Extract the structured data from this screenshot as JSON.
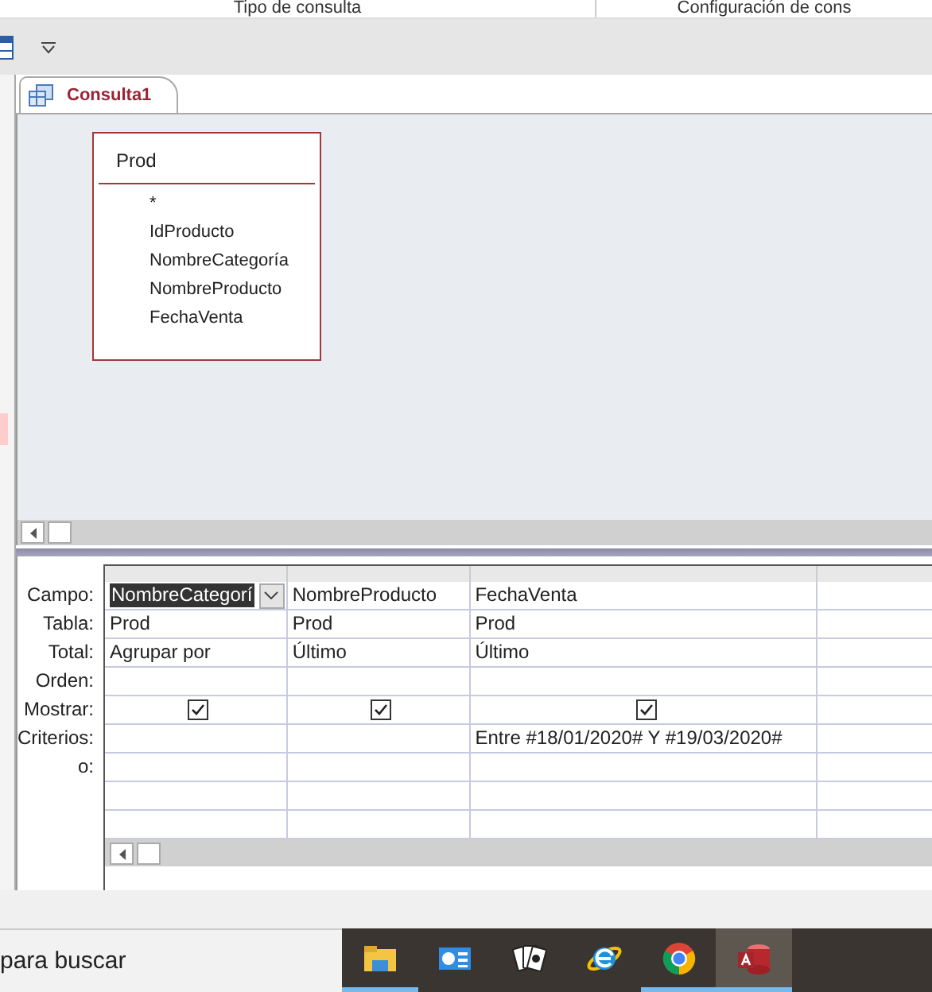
{
  "ribbon_groups": [
    "Tipo de consulta",
    "Configuración de cons"
  ],
  "document_tab": {
    "label": "Consulta1",
    "selected": true
  },
  "table_box": {
    "title": "Prod",
    "fields": [
      "*",
      "IdProducto",
      "NombreCategoría",
      "NombreProducto",
      "FechaVenta"
    ]
  },
  "grid": {
    "rows": [
      {
        "label": "Campo:",
        "kind": "campo"
      },
      {
        "label": "Tabla:",
        "kind": "tabla"
      },
      {
        "label": "Total:",
        "kind": "total"
      },
      {
        "label": "Orden:",
        "kind": "orden"
      },
      {
        "label": "Mostrar:",
        "kind": "mostrar"
      },
      {
        "label": "Criterios:",
        "kind": "criterios"
      },
      {
        "label": "o:",
        "kind": "o"
      }
    ],
    "columns": [
      {
        "campo": "NombreCategorí",
        "selected": true,
        "tabla": "Prod",
        "total": "Agrupar por",
        "mostrar": true
      },
      {
        "campo": "NombreProducto",
        "selected": false,
        "tabla": "Prod",
        "total": "Último",
        "mostrar": true
      },
      {
        "campo": "FechaVenta",
        "selected": false,
        "tabla": "Prod",
        "total": "Último",
        "mostrar": true,
        "criterios": "Entre #18/01/2020# Y #19/03/2020#"
      }
    ]
  },
  "taskbar": {
    "search_placeholder": "para buscar",
    "apps": [
      {
        "kind": "folder",
        "running": true,
        "active": false
      },
      {
        "kind": "panel",
        "running": false,
        "active": false
      },
      {
        "kind": "cards",
        "running": false,
        "active": false
      },
      {
        "kind": "ie",
        "running": false,
        "active": false
      },
      {
        "kind": "chrome",
        "running": true,
        "active": false
      },
      {
        "kind": "access",
        "running": true,
        "active": true
      }
    ]
  }
}
